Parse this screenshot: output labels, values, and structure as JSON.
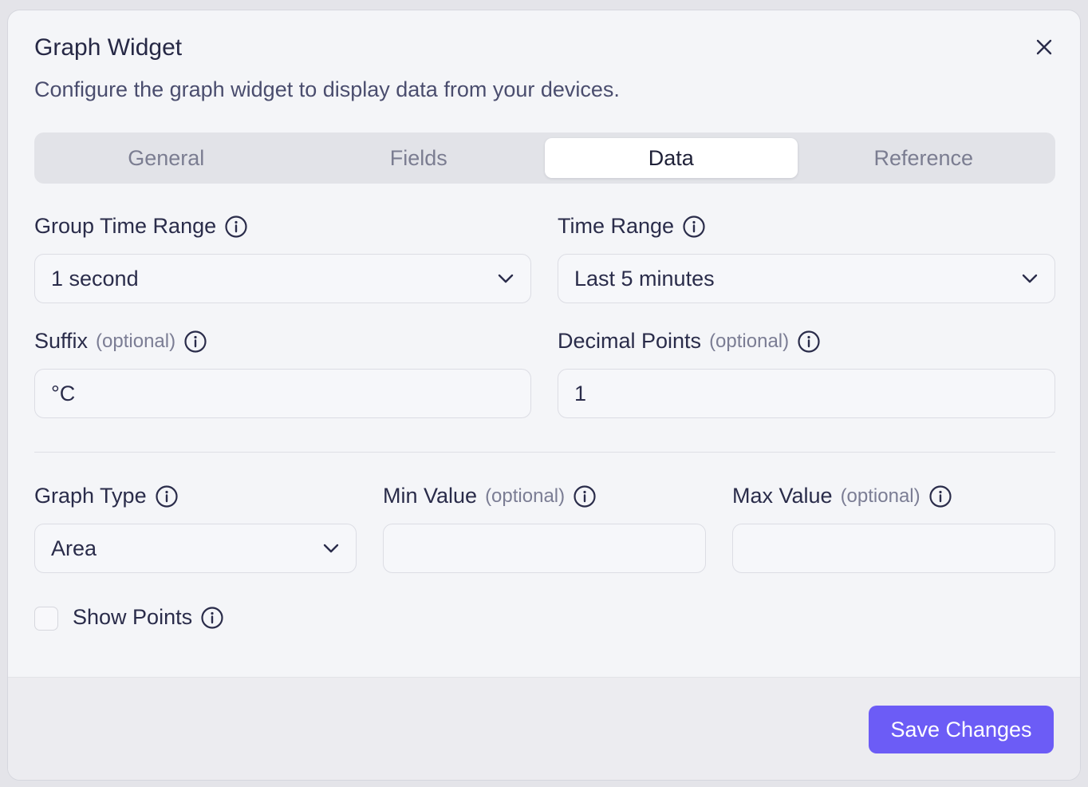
{
  "dialog": {
    "title": "Graph Widget",
    "description": "Configure the graph widget to display data from your devices."
  },
  "tabs": [
    {
      "label": "General",
      "active": false
    },
    {
      "label": "Fields",
      "active": false
    },
    {
      "label": "Data",
      "active": true
    },
    {
      "label": "Reference",
      "active": false
    }
  ],
  "form": {
    "group_time_range": {
      "label": "Group Time Range",
      "value": "1 second"
    },
    "time_range": {
      "label": "Time Range",
      "value": "Last 5 minutes"
    },
    "suffix": {
      "label": "Suffix",
      "optional": "(optional)",
      "value": "°C"
    },
    "decimal_points": {
      "label": "Decimal Points",
      "optional": "(optional)",
      "value": "1"
    },
    "graph_type": {
      "label": "Graph Type",
      "value": "Area"
    },
    "min_value": {
      "label": "Min Value",
      "optional": "(optional)",
      "value": ""
    },
    "max_value": {
      "label": "Max Value",
      "optional": "(optional)",
      "value": ""
    },
    "show_points": {
      "label": "Show Points",
      "checked": false
    }
  },
  "footer": {
    "save_label": "Save Changes"
  },
  "colors": {
    "accent": "#6c5cf6",
    "background": "#f4f5f8",
    "tab_bar": "#e2e3e8"
  },
  "icons": {
    "close": "close-icon",
    "info": "info-icon",
    "chevron": "chevron-down-icon"
  }
}
